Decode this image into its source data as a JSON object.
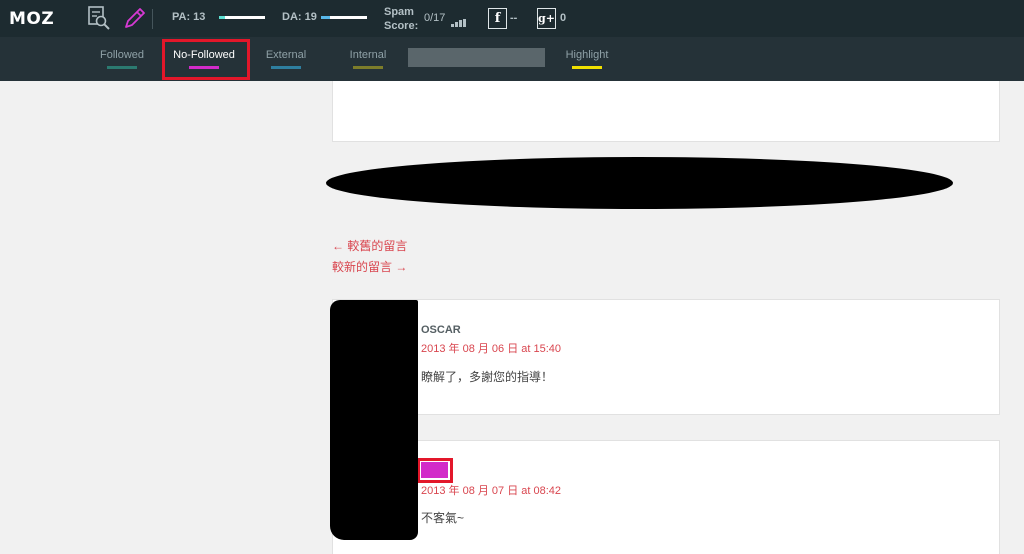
{
  "toolbar": {
    "logo": "MOZ",
    "pa_label": "PA: 13",
    "pa_value": 13,
    "da_label": "DA: 19",
    "da_value": 19,
    "spam_label_1": "Spam",
    "spam_label_2": "Score:",
    "spam_value": "0/17",
    "facebook_glyph": "f",
    "facebook_count": "--",
    "gplus_glyph": "g+",
    "gplus_count": "0",
    "colors": {
      "pa_fill": "#5de0d2",
      "da_fill": "#58b8ea",
      "pencil": "#d63ad3"
    }
  },
  "filters": {
    "followed": "Followed",
    "nofollowed": "No-Followed",
    "external": "External",
    "internal": "Internal",
    "highlight": "Highlight",
    "colors": {
      "followed": "#2b7a70",
      "nofollowed": "#d22bc9",
      "external": "#2e7fa0",
      "internal": "#7d7d2a",
      "highlight": "#f0e000"
    }
  },
  "nav": {
    "older": "← 較舊的留言",
    "newer": "較新的留言 →"
  },
  "comments": [
    {
      "author": "OSCAR",
      "date": "2013 年 08 月 06 日 at 15:40",
      "text": "瞭解了，多謝您的指導！"
    },
    {
      "author": "",
      "date": "2013 年 08 月 07 日 at 08:42",
      "text": "不客氣~"
    }
  ]
}
